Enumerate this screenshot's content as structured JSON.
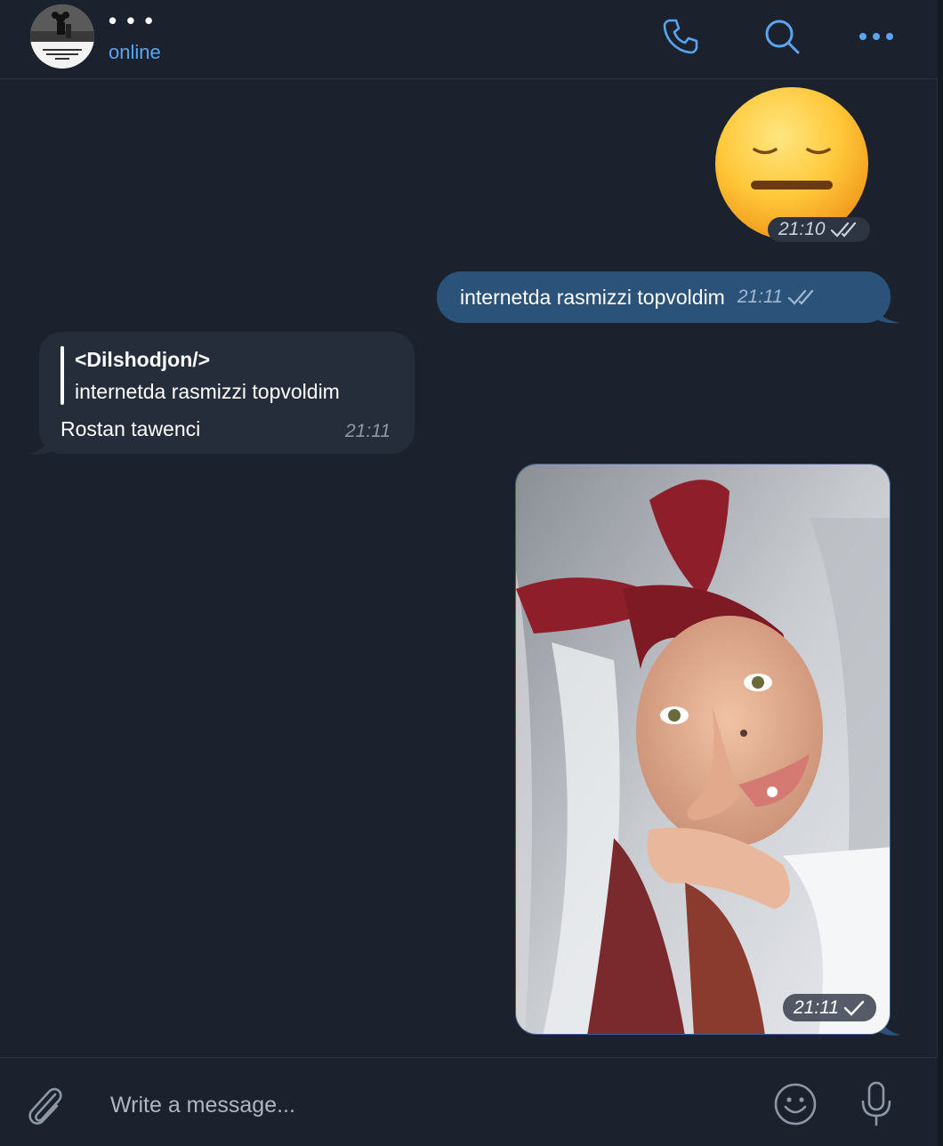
{
  "header": {
    "title": "• • •",
    "status": "online"
  },
  "messages": {
    "sticker": {
      "emoji": "expressionless-face",
      "time": "21:10",
      "ticks": "double"
    },
    "outgoing_text": {
      "text": "internetda rasmizzi topvoldim",
      "time": "21:11",
      "ticks": "double"
    },
    "incoming_reply": {
      "reply_author": "<Dilshodjon/>",
      "reply_text": "internetda rasmizzi topvoldim",
      "text": "Rostan tawenci",
      "time": "21:11"
    },
    "photo": {
      "time": "21:11",
      "ticks": "single"
    }
  },
  "composer": {
    "placeholder": "Write a message..."
  },
  "colors": {
    "background": "#1b222d",
    "outgoing_bubble": "#2b5278",
    "incoming_bubble": "#252d3a",
    "accent": "#5aa5f0"
  }
}
